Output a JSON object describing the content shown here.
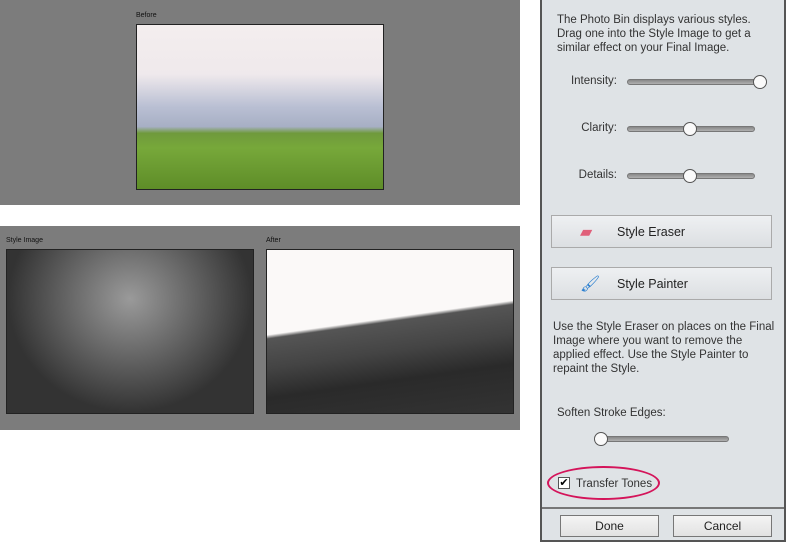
{
  "before": {
    "label": "Before"
  },
  "style_image": {
    "label": "Style Image"
  },
  "after": {
    "label": "After"
  },
  "panel": {
    "intro": "The Photo Bin displays various styles. Drag one into the Style Image to get a similar effect on your Final Image.",
    "sliders": [
      {
        "label": "Intensity:",
        "value": 1.0
      },
      {
        "label": "Clarity:",
        "value": 0.5
      },
      {
        "label": "Details:",
        "value": 0.5
      }
    ],
    "eraser_label": "Style Eraser",
    "painter_label": "Style Painter",
    "help": "Use the Style Eraser on places on the Final Image where you want to remove the applied effect. Use the Style Painter to repaint the Style.",
    "soften_label": "Soften Stroke Edges:",
    "soften_value": 0.0,
    "transfer_tones_label": "Transfer Tones",
    "transfer_tones_checked": true,
    "done_label": "Done",
    "cancel_label": "Cancel",
    "highlight_color": "#d4145a"
  }
}
